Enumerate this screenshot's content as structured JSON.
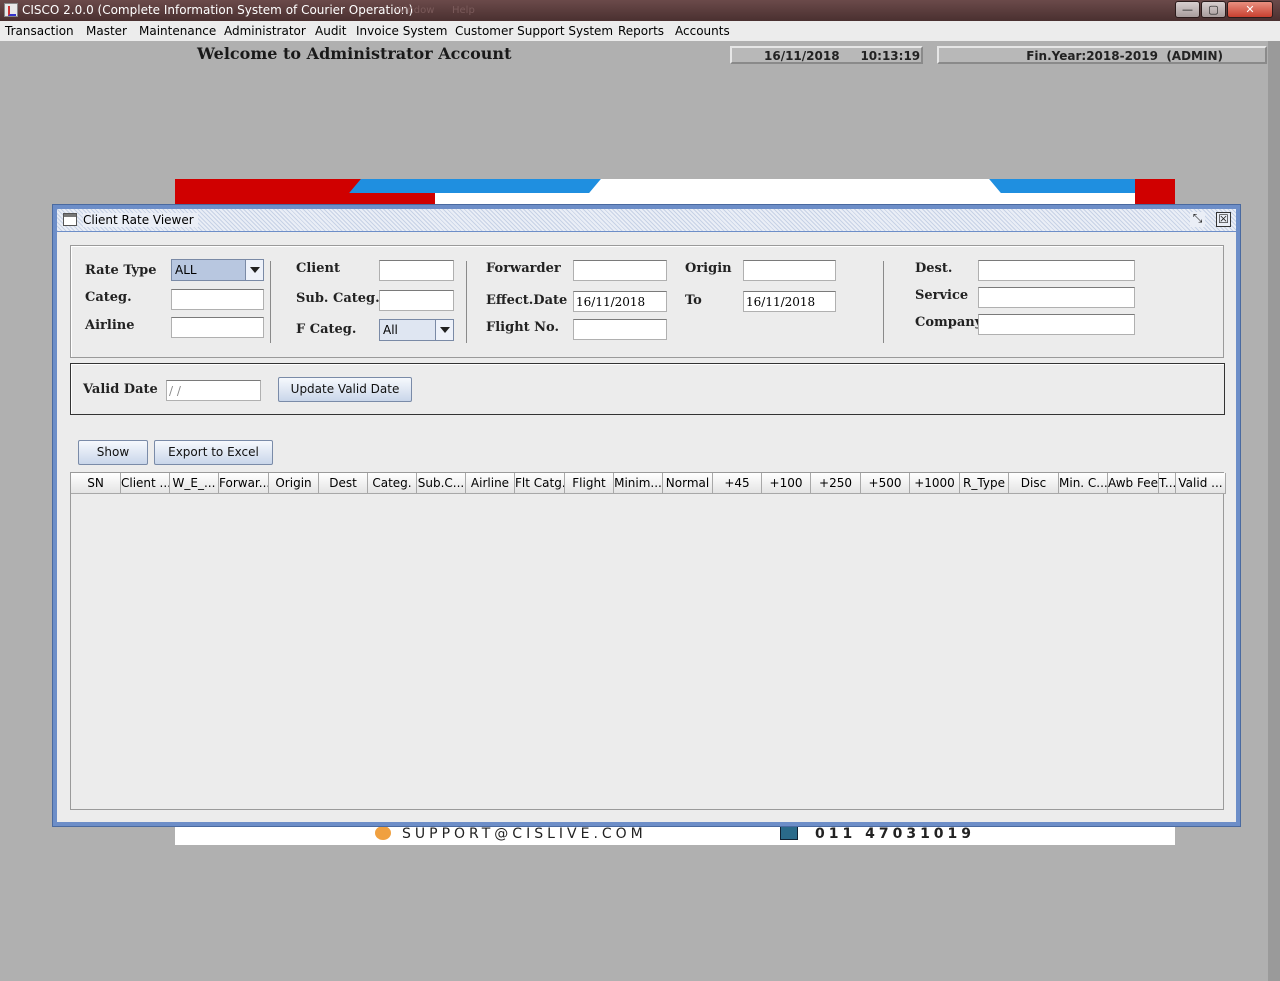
{
  "window": {
    "title": "CISCO 2.0.0 (Complete Information System of Courier Operation)",
    "ghost_menu": [
      "Window",
      "Help"
    ],
    "buttons": {
      "minimize": "—",
      "maximize": "▢",
      "close": "✕"
    }
  },
  "menubar": {
    "items": [
      {
        "label": "Transaction"
      },
      {
        "label": "Master"
      },
      {
        "label": "Maintenance"
      },
      {
        "label": "Administrator"
      },
      {
        "label": "Audit"
      },
      {
        "label": "Invoice System"
      },
      {
        "label": "Customer Support System"
      },
      {
        "label": "Reports"
      },
      {
        "label": "Accounts"
      }
    ]
  },
  "header": {
    "welcome": "Welcome to Administrator Account",
    "datetime": "16/11/2018     10:13:19",
    "fin_year": "Fin.Year:2018-2019  (ADMIN)"
  },
  "banner": {
    "email": "SUPPORT@CISLIVE.COM",
    "phone": "011 47031019"
  },
  "frame": {
    "title": "Client Rate Viewer",
    "restore_icon": "⤡",
    "close_icon": "☒"
  },
  "filters": {
    "rate_type": {
      "label": "Rate Type",
      "value": "ALL"
    },
    "categ": {
      "label": "Categ.",
      "value": ""
    },
    "airline": {
      "label": "Airline",
      "value": ""
    },
    "client": {
      "label": "Client",
      "value": ""
    },
    "sub_categ": {
      "label": "Sub. Categ.",
      "value": ""
    },
    "f_categ": {
      "label": "F Categ.",
      "value": "All"
    },
    "forwarder": {
      "label": "Forwarder",
      "value": ""
    },
    "effect_date": {
      "label": "Effect.Date",
      "value": "16/11/2018"
    },
    "flight_no": {
      "label": "Flight No.",
      "value": ""
    },
    "origin": {
      "label": "Origin",
      "value": ""
    },
    "to": {
      "label": "To",
      "value": "16/11/2018"
    },
    "dest": {
      "label": "Dest.",
      "value": ""
    },
    "service": {
      "label": "Service",
      "value": ""
    },
    "company": {
      "label": "Company",
      "value": ""
    }
  },
  "valid": {
    "label": "Valid Date",
    "value": "/ /",
    "update_button": "Update Valid Date"
  },
  "actions": {
    "show": "Show",
    "export": "Export to Excel"
  },
  "table": {
    "columns": [
      "SN",
      "Client ...",
      "W_E_...",
      "Forwar...",
      "Origin",
      "Dest",
      "Categ.",
      "Sub.C...",
      "Airline",
      "Flt Catg.",
      "Flight",
      "Minim...",
      "Normal",
      "+45",
      "+100",
      "+250",
      "+500",
      "+1000",
      "R_Type",
      "Disc",
      "Min. C...",
      "Awb Fee",
      "T...",
      "Valid ..."
    ],
    "rows": []
  }
}
